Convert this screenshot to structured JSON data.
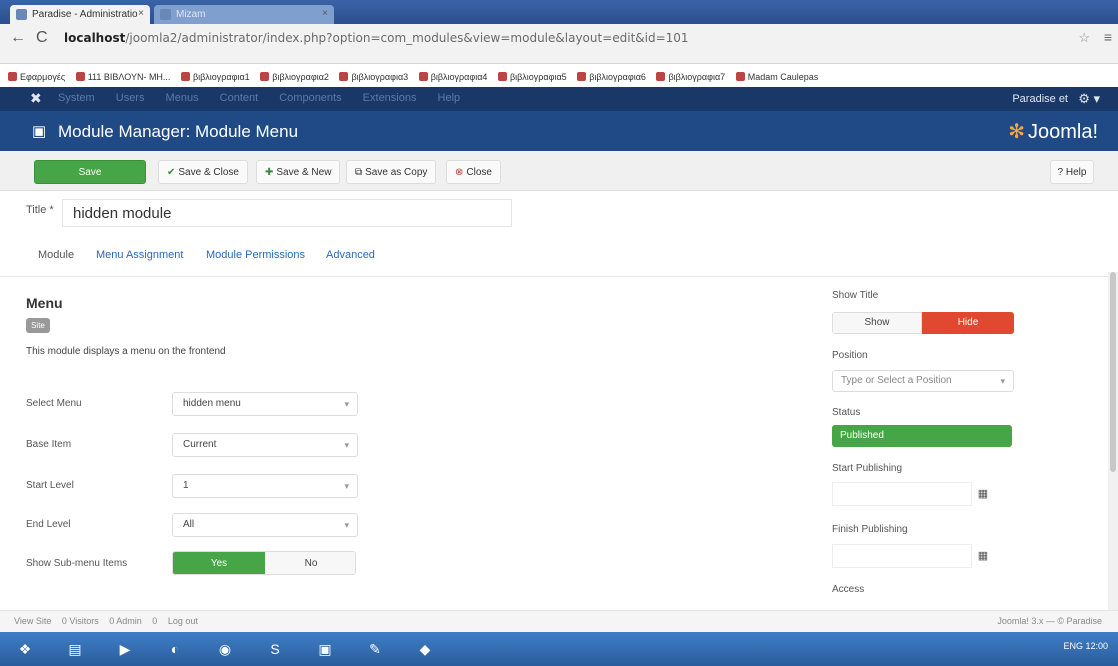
{
  "browser": {
    "tabs": [
      {
        "label": "Paradise - Administratio"
      },
      {
        "label": "Mizam"
      }
    ],
    "url_host": "localhost",
    "url_path": "/joomla2/administrator/index.php?option=com_modules&view=module&layout=edit&id=101",
    "bookmarks": [
      "Εφαρμογές",
      "111 ΒΙΒΛΟΥΝ- ΜΗ...",
      "βιβλιογραφια1",
      "βιβλιογραφια2",
      "βιβλιογραφια3",
      "βιβλιογραφια4",
      "βιβλιογραφια5",
      "βιβλιογραφια6",
      "βιβλιογραφια7",
      "Madam Caulepas"
    ]
  },
  "topnav": {
    "menu": [
      "System",
      "Users",
      "Menus",
      "Content",
      "Components",
      "Extensions",
      "Help"
    ],
    "user": "Paradise et",
    "gear": "⚙ ▾"
  },
  "header": {
    "title": "Module Manager: Module Menu",
    "brand": "Joomla!"
  },
  "toolbar": {
    "save": "Save",
    "save_close": "Save & Close",
    "save_new": "Save & New",
    "save_copy": "Save as Copy",
    "close": "Close",
    "help": "Help"
  },
  "form": {
    "title_label": "Title *",
    "title_value": "hidden module",
    "tabs": [
      "Module",
      "Menu Assignment",
      "Module Permissions",
      "Advanced"
    ],
    "module_name": "Menu",
    "badge": "Site",
    "description": "This module displays a menu on the frontend",
    "fields": [
      {
        "label": "Select Menu",
        "value": "hidden menu"
      },
      {
        "label": "Base Item",
        "value": "Current"
      },
      {
        "label": "Start Level",
        "value": "1"
      },
      {
        "label": "End Level",
        "value": "All"
      }
    ],
    "submenu_label": "Show Sub-menu Items",
    "submenu_yes": "Yes",
    "submenu_no": "No"
  },
  "right": {
    "show_title_label": "Show Title",
    "show_title_show": "Show",
    "show_title_hide": "Hide",
    "position_label": "Position",
    "position_placeholder": "Type or Select a Position",
    "status_label": "Status",
    "status_value": "Published",
    "start_publishing_label": "Start Publishing",
    "finish_publishing_label": "Finish Publishing",
    "access_label": "Access"
  },
  "footer": {
    "items": [
      "View Site",
      "0 Visitors",
      "0 Admin",
      "0",
      "Log out"
    ],
    "copy": "Joomla! 3.x — © Paradise"
  },
  "taskbar": {
    "tray": "ENG 12:00"
  }
}
